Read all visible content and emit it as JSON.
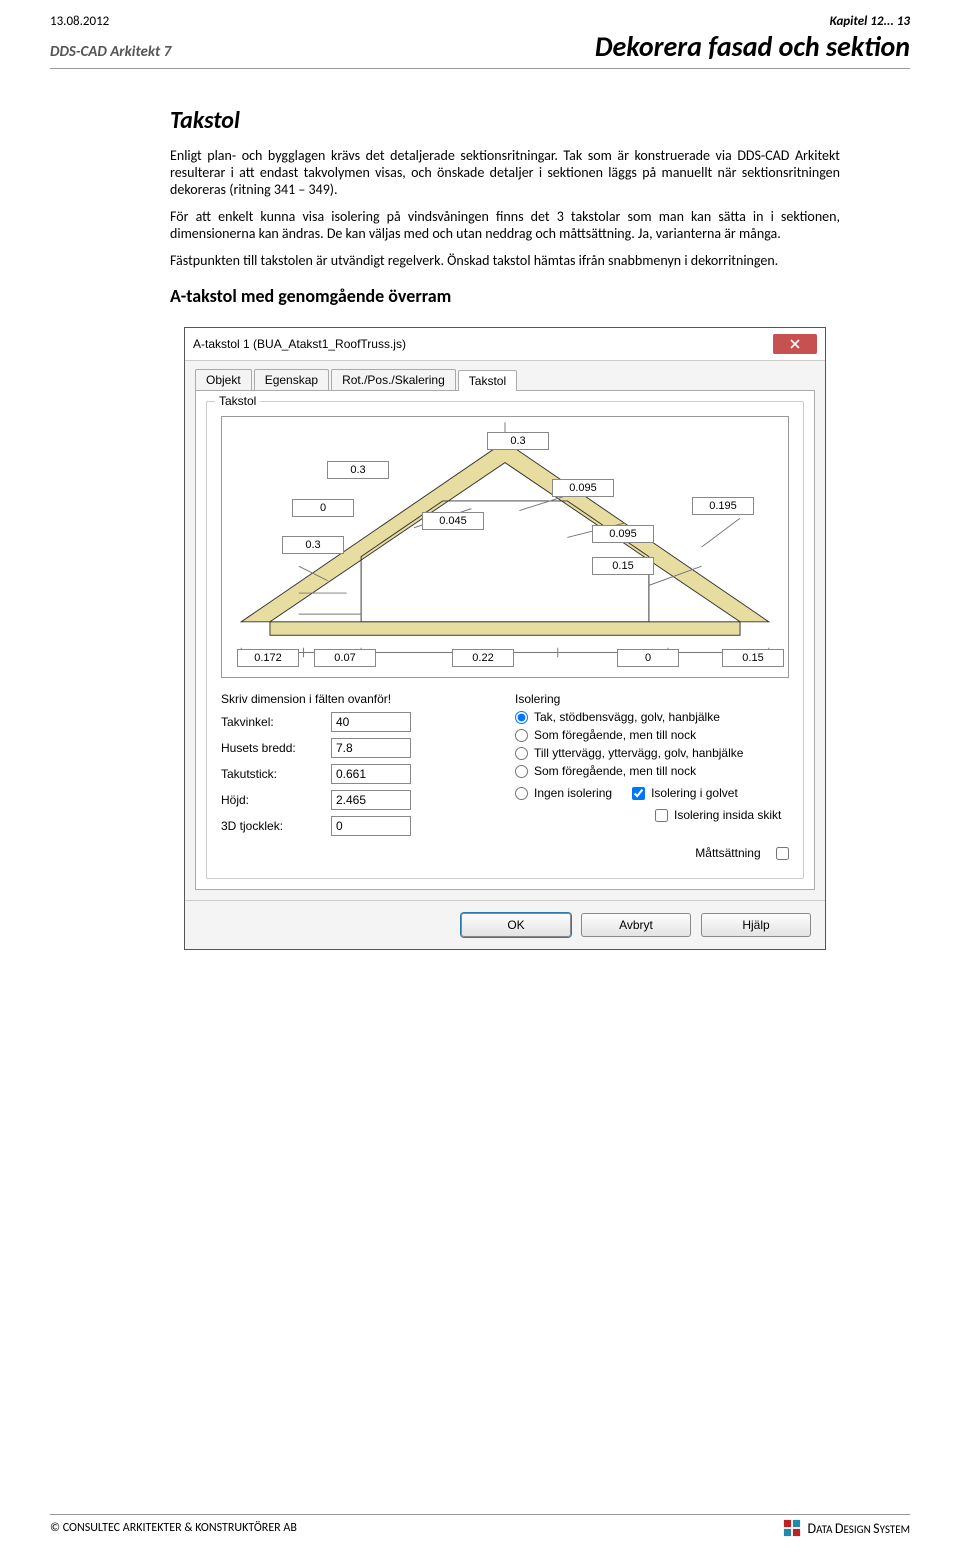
{
  "header": {
    "date": "13.08.2012",
    "chapter": "Kapitel 12... 13",
    "product": "DDS-CAD Arkitekt 7",
    "title": "Dekorera fasad och sektion"
  },
  "section": {
    "heading": "Takstol",
    "p1": "Enligt plan- och bygglagen krävs det detaljerade sektionsritningar. Tak som är konstruerade via DDS-CAD Arkitekt resulterar i att endast takvolymen visas, och önskade detaljer i sektionen läggs på manuellt när sektionsritningen dekoreras (ritning 341 – 349).",
    "p2": "För att enkelt kunna visa isolering på vindsvåningen finns det 3 takstolar som man kan sätta in i sektionen, dimensionerna kan ändras. De kan väljas med och utan neddrag och måttsättning. Ja, varianterna är många.",
    "p3": "Fästpunkten till takstolen är utvändigt regelverk. Önskad takstol hämtas ifrån snabbmenyn i dekorritningen.",
    "sub": "A-takstol med genomgående överram"
  },
  "dialog": {
    "caption": "A-takstol 1 (BUA_Atakst1_RoofTruss.js)",
    "tabs": [
      "Objekt",
      "Egenskap",
      "Rot./Pos./Skalering",
      "Takstol"
    ],
    "active_tab": 3,
    "group": "Takstol",
    "dims": {
      "top": "0.3",
      "l1": "0.3",
      "l2": "0",
      "l3": "0.3",
      "r1": "0.095",
      "r2": "0.045",
      "r3": "0.095",
      "r4": "0.15",
      "r5": "0.195",
      "b1": "0.172",
      "b2": "0.07",
      "b3": "0.22",
      "b4": "0",
      "b5": "0.15"
    },
    "form_note": "Skriv dimension i fälten ovanför!",
    "fields": [
      {
        "label": "Takvinkel:",
        "value": "40"
      },
      {
        "label": "Husets bredd:",
        "value": "7.8"
      },
      {
        "label": "Takutstick:",
        "value": "0.661"
      },
      {
        "label": "Höjd:",
        "value": "2.465"
      },
      {
        "label": "3D tjocklek:",
        "value": "0"
      }
    ],
    "iso_label": "Isolering",
    "radios": [
      "Tak, stödbensvägg, golv, hanbjälke",
      "Som föregående, men till nock",
      "Till yttervägg, yttervägg, golv, hanbjälke",
      "Som föregående, men till nock",
      "Ingen isolering"
    ],
    "radio_selected": 0,
    "checks": {
      "golvet": {
        "label": "Isolering i golvet",
        "checked": true
      },
      "insida": {
        "label": "Isolering insida skikt",
        "checked": false
      }
    },
    "matt": {
      "label": "Måttsättning",
      "checked": false
    },
    "buttons": {
      "ok": "OK",
      "cancel": "Avbryt",
      "help": "Hjälp"
    }
  },
  "footer": {
    "left": "©  CONSULTEC ARKITEKTER & KONSTRUKTÖRER AB",
    "right_prefix": "D",
    "right_bold1": "ATA ",
    "right_mid": "D",
    "right_bold2": "ESIGN ",
    "right_end": "S",
    "right_bold3": "YSTEM"
  }
}
